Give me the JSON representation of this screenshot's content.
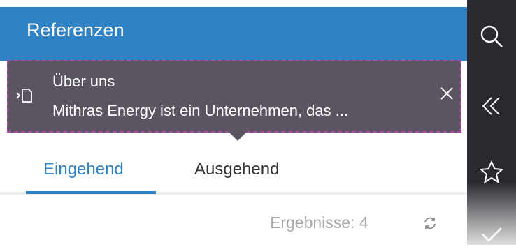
{
  "header": {
    "title": "Referenzen"
  },
  "tooltip": {
    "title": "Über uns",
    "body": "Mithras Energy ist ein Unternehmen, das ...",
    "icon": "page-link-icon",
    "close_icon": "close-icon"
  },
  "tabs": [
    {
      "label": "Eingehend",
      "active": true
    },
    {
      "label": "Ausgehend",
      "active": false
    }
  ],
  "results": {
    "label": "Ergebnisse: 4"
  },
  "sidebar": {
    "icons": [
      "search-icon",
      "collapse-icon",
      "star-icon",
      "check-icon"
    ]
  },
  "colors": {
    "accent": "#2f82c4",
    "tooltip_bg": "#5a5560",
    "sidebar_bg": "#2b2930"
  }
}
